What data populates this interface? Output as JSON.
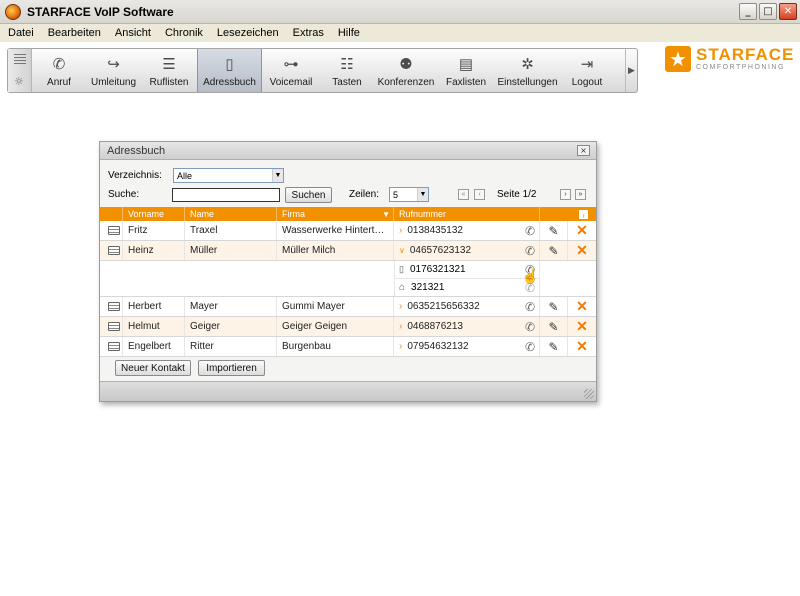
{
  "window": {
    "title": "STARFACE VoIP Software",
    "min": "_",
    "max": "□",
    "close": "✕"
  },
  "menu": [
    "Datei",
    "Bearbeiten",
    "Ansicht",
    "Chronik",
    "Lesezeichen",
    "Extras",
    "Hilfe"
  ],
  "toolbar": {
    "items": [
      {
        "label": "Anruf",
        "icon": "phone-handset-icon",
        "glyph": "✆"
      },
      {
        "label": "Umleitung",
        "icon": "redirect-icon",
        "glyph": "↪"
      },
      {
        "label": "Ruflisten",
        "icon": "list-icon",
        "glyph": "☰"
      },
      {
        "label": "Adressbuch",
        "icon": "address-book-icon",
        "glyph": "▯"
      },
      {
        "label": "Voicemail",
        "icon": "voicemail-icon",
        "glyph": "⊶"
      },
      {
        "label": "Tasten",
        "icon": "keys-icon",
        "glyph": "☷"
      },
      {
        "label": "Konferenzen",
        "icon": "conference-icon",
        "glyph": "⚉"
      },
      {
        "label": "Faxlisten",
        "icon": "fax-icon",
        "glyph": "▤"
      },
      {
        "label": "Einstellungen",
        "icon": "gear-icon",
        "glyph": "✲"
      },
      {
        "label": "Logout",
        "icon": "logout-icon",
        "glyph": "⇥"
      }
    ],
    "active": "Adressbuch"
  },
  "logo": {
    "name": "STARFACE",
    "tagline": "COMFORTPHONING",
    "color": "#f29100"
  },
  "dialog": {
    "title": "Adressbuch",
    "close": "×",
    "directory_label": "Verzeichnis:",
    "directory_value": "Alle",
    "search_label": "Suche:",
    "search_value": "",
    "search_button": "Suchen",
    "rows_label": "Zeilen:",
    "rows_value": "5",
    "page_first": "«",
    "page_prev": "‹",
    "page_next": "›",
    "page_last": "»",
    "page_text": "Seite 1/2",
    "columns": [
      "Vorname",
      "Name",
      "Firma",
      "Rufnummer"
    ],
    "sort_indicator": "▼",
    "column_menu": "›",
    "contacts": [
      {
        "vorname": "Fritz",
        "name": "Traxel",
        "firma": "Wasserwerke Hintert…",
        "nummer": "0138435132"
      },
      {
        "vorname": "Heinz",
        "name": "Müller",
        "firma": "Müller Milch",
        "nummer": "04657623132",
        "expanded": true,
        "extra_numbers": [
          {
            "type": "mobile-icon",
            "glyph": "▯",
            "nummer": "0176321321"
          },
          {
            "type": "home-icon",
            "glyph": "⌂",
            "nummer": "321321"
          }
        ]
      },
      {
        "vorname": "Herbert",
        "name": "Mayer",
        "firma": "Gummi Mayer",
        "nummer": "0635215656332"
      },
      {
        "vorname": "Helmut",
        "name": "Geiger",
        "firma": "Geiger Geigen",
        "nummer": "0468876213"
      },
      {
        "vorname": "Engelbert",
        "name": "Ritter",
        "firma": "Burgenbau",
        "nummer": "07954632132"
      }
    ],
    "new_contact_button": "Neuer Kontakt",
    "import_button": "Importieren"
  }
}
